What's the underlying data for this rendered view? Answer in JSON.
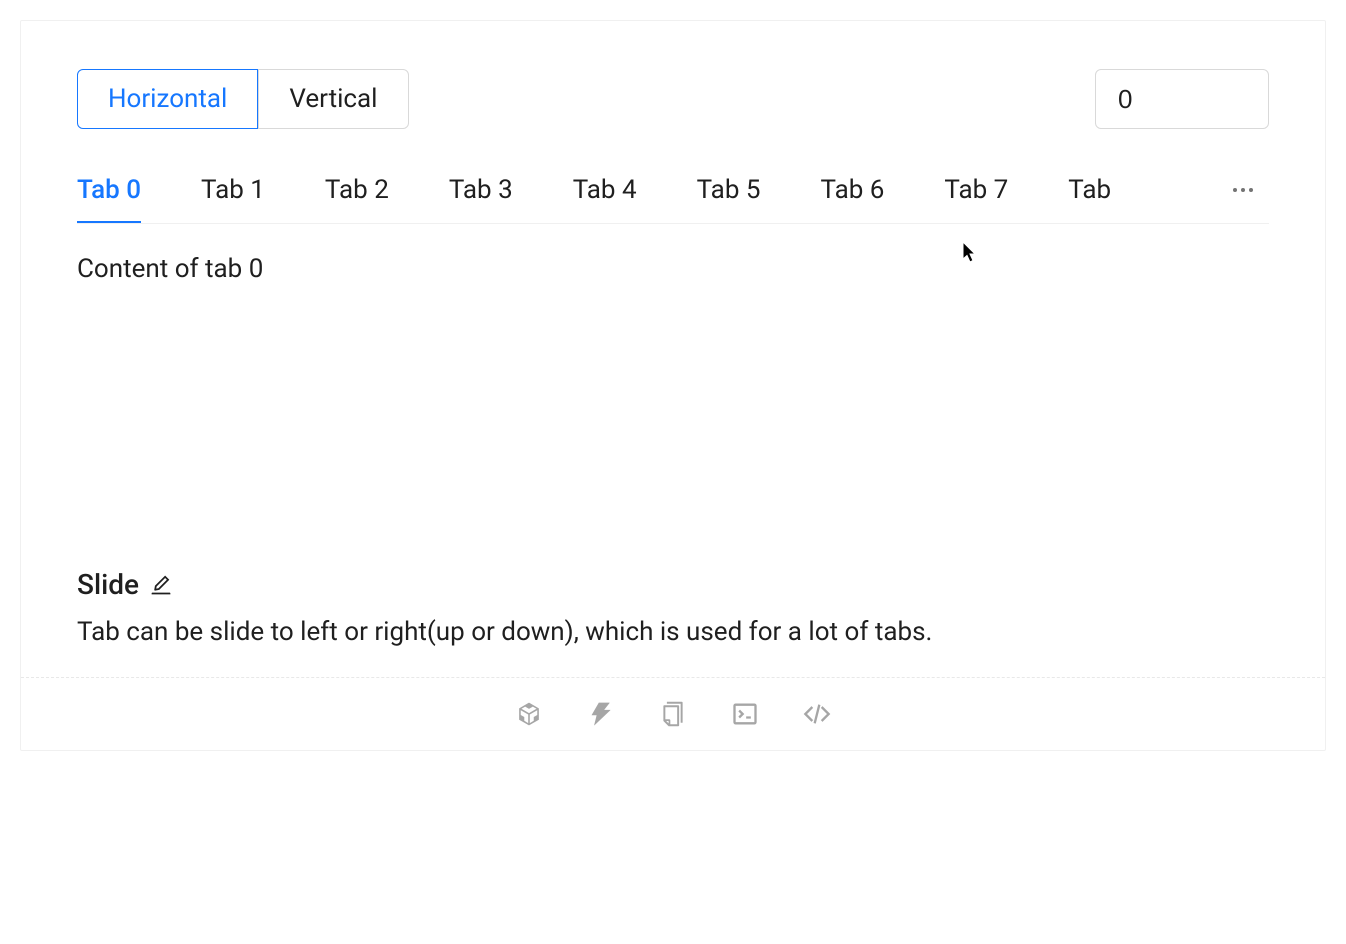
{
  "orientation": {
    "options": [
      "Horizontal",
      "Vertical"
    ],
    "active_index": 0
  },
  "number_input": {
    "value": "0"
  },
  "tabs": {
    "items": [
      {
        "label": "Tab 0"
      },
      {
        "label": "Tab 1"
      },
      {
        "label": "Tab 2"
      },
      {
        "label": "Tab 3"
      },
      {
        "label": "Tab 4"
      },
      {
        "label": "Tab 5"
      },
      {
        "label": "Tab 6"
      },
      {
        "label": "Tab 7"
      },
      {
        "label": "Tab"
      }
    ],
    "active_index": 0,
    "content": "Content of tab 0"
  },
  "section": {
    "heading": "Slide",
    "description": "Tab can be slide to left or right(up or down), which is used for a lot of tabs."
  }
}
